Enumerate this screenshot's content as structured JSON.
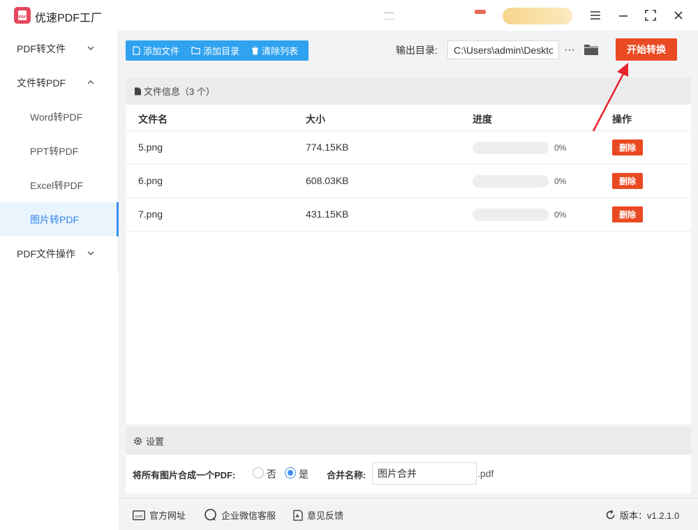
{
  "app": {
    "title": "优速PDF工厂",
    "logo_text": "PDF"
  },
  "sidebar": {
    "items": [
      {
        "label": "PDF转文件"
      },
      {
        "label": "文件转PDF"
      },
      {
        "label": "Word转PDF"
      },
      {
        "label": "PPT转PDF"
      },
      {
        "label": "Excel转PDF"
      },
      {
        "label": "图片转PDF"
      },
      {
        "label": "PDF文件操作"
      }
    ]
  },
  "toolbar": {
    "add_file": "添加文件",
    "add_dir": "添加目录",
    "clear_list": "清除列表",
    "output_label": "输出目录:",
    "output_path": "C:\\Users\\admin\\Deskto",
    "more": "···",
    "start": "开始转换"
  },
  "file_panel": {
    "header": "文件信息（3 个）",
    "columns": {
      "name": "文件名",
      "size": "大小",
      "progress": "进度",
      "action": "操作"
    },
    "rows": [
      {
        "name": "5.png",
        "size": "774.15KB",
        "progress": "0%",
        "progress_value": 0,
        "action": "删除"
      },
      {
        "name": "6.png",
        "size": "608.03KB",
        "progress": "0%",
        "progress_value": 0,
        "action": "删除"
      },
      {
        "name": "7.png",
        "size": "431.15KB",
        "progress": "0%",
        "progress_value": 0,
        "action": "删除"
      }
    ]
  },
  "settings": {
    "header": "设置",
    "merge_label": "将所有图片合成一个PDF:",
    "option_no": "否",
    "option_yes": "是",
    "selected": "是",
    "name_label": "合并名称:",
    "name_value": "图片合并",
    "ext": ".pdf"
  },
  "footer": {
    "website": "官方网址",
    "wechat": "企业微信客服",
    "feedback": "意见反馈",
    "version": "版本：v1.2.1.0"
  },
  "colors": {
    "accent_blue": "#2fa2f0",
    "start_red": "#ea4a22",
    "active_blue": "#3b8ff0"
  }
}
